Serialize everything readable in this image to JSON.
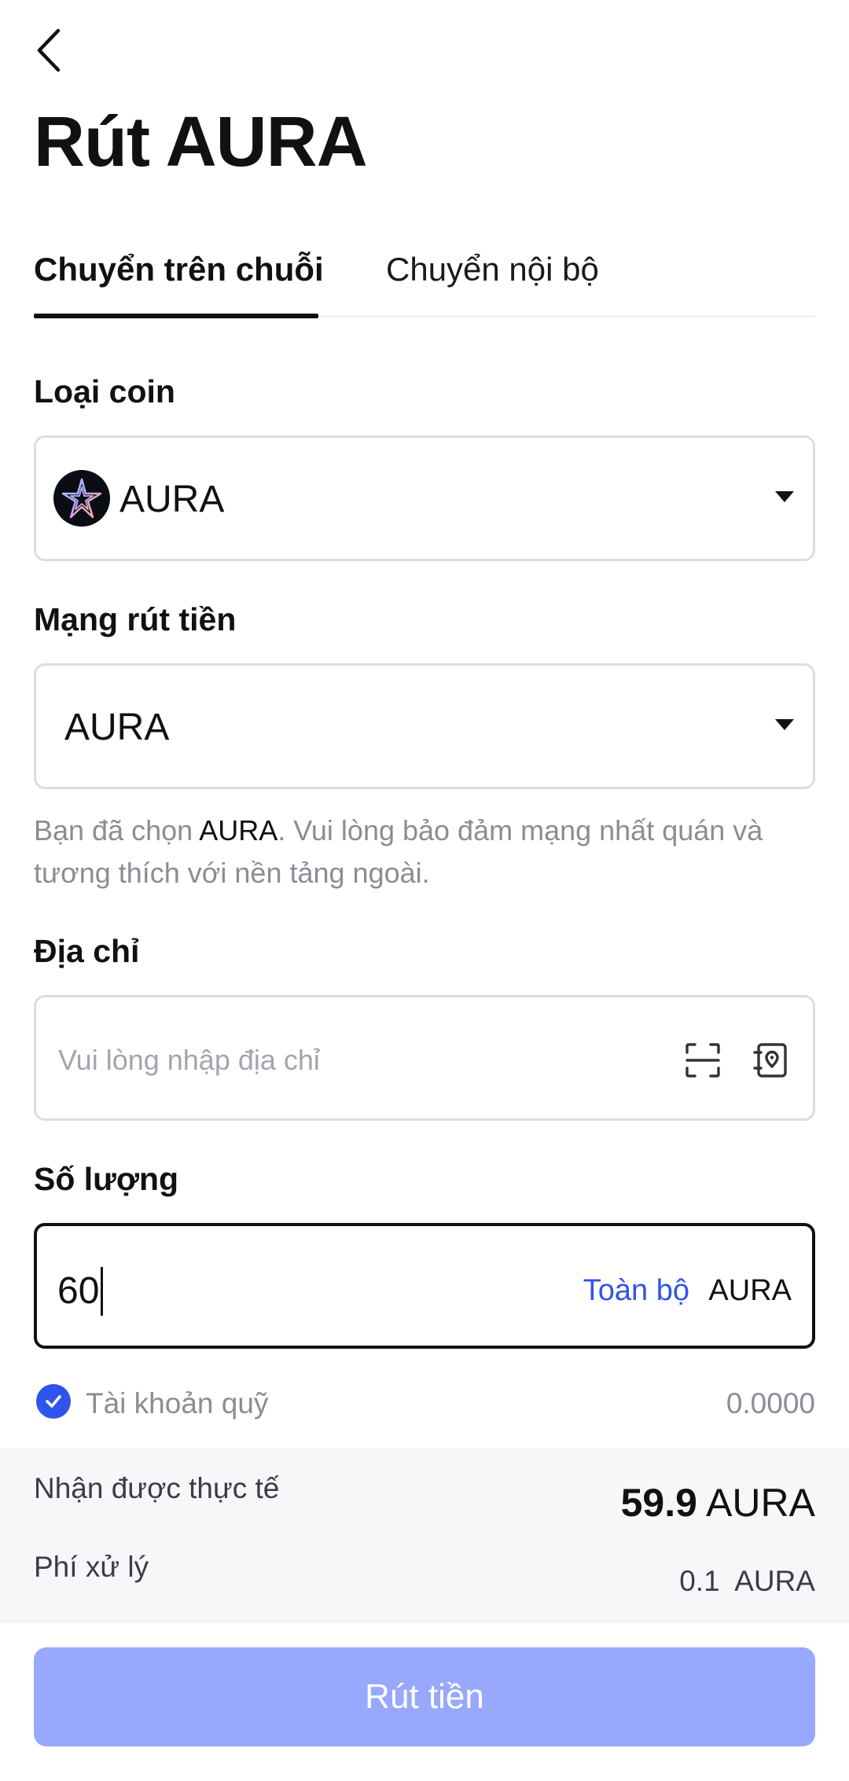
{
  "header": {
    "title": "Rút AURA"
  },
  "tabs": [
    {
      "label": "Chuyển trên chuỗi",
      "active": true
    },
    {
      "label": "Chuyển nội bộ",
      "active": false
    }
  ],
  "coin": {
    "label": "Loại coin",
    "value": "AURA",
    "icon": "aura-coin-logo"
  },
  "network": {
    "label": "Mạng rút tiền",
    "value": "AURA",
    "note_prefix": "Bạn đã chọn ",
    "note_highlight": "AURA",
    "note_suffix": ". Vui lòng bảo đảm mạng nhất quán và tương thích với nền tảng ngoài."
  },
  "address": {
    "label": "Địa chỉ",
    "placeholder": "Vui lòng nhập địa chỉ",
    "icons": [
      "scan-icon",
      "address-book-icon"
    ]
  },
  "amount": {
    "label": "Số lượng",
    "value": "60",
    "all_label": "Toàn bộ",
    "unit": "AURA"
  },
  "fund_account": {
    "label": "Tài khoản quỹ",
    "value": "0.0000",
    "checked": true
  },
  "summary": {
    "received_label": "Nhận được thực tế",
    "received_amount": "59.9",
    "received_unit": "AURA",
    "fee_label": "Phí xử lý",
    "fee_amount": "0.1",
    "fee_unit": "AURA"
  },
  "submit": {
    "label": "Rút tiền"
  },
  "colors": {
    "accent": "#2f54eb",
    "button_disabled": "#97a8fd",
    "muted_text": "#8a8d96"
  }
}
